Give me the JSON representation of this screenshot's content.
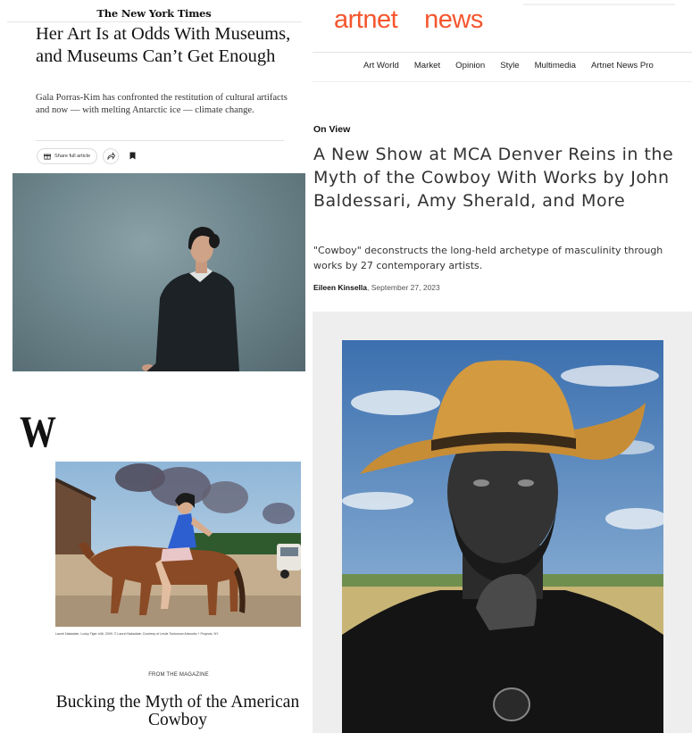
{
  "nyt": {
    "masthead": "The New York Times",
    "headline": "Her Art Is at Odds With Museums, and Museums Can’t Get Enough",
    "summary": "Gala Porras-Kim has confronted the restitution of cultural artifacts and now — with melting Antarctic ice — climate change.",
    "share_label": "Share full article",
    "icons": [
      "gift-icon",
      "share-icon",
      "bookmark-icon"
    ]
  },
  "wmag": {
    "logo": "W",
    "caption": "Laurel Nakadate, Lucky Tiger #46, 2009. © Laurel Nakadate; Courtesy of Leslie Tonkonow Artworks + Projects, NY.",
    "kicker": "FROM THE MAGAZINE",
    "title": "Bucking the Myth of the American Cowboy"
  },
  "artnet": {
    "logo_left": "artnet",
    "logo_right": "news",
    "brand_color": "#f5552d",
    "nav": [
      "Art World",
      "Market",
      "Opinion",
      "Style",
      "Multimedia",
      "Artnet News Pro"
    ],
    "kicker": "On View",
    "headline": "A New Show at MCA Denver Reins in the Myth of the Cowboy With Works by John Baldessari, Amy Sherald, and More",
    "dek": "\"Cowboy\" deconstructs the long-held archetype of masculinity through works by 27 contemporary artists.",
    "byline_author": "Eileen Kinsella",
    "byline_date": ", September 27, 2023"
  }
}
